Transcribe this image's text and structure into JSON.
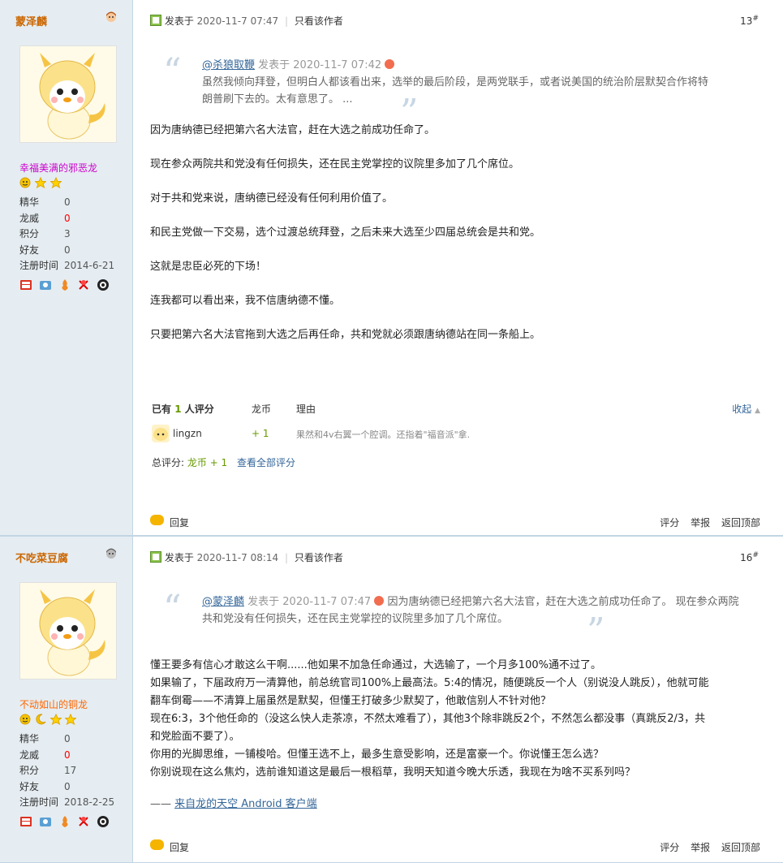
{
  "posts": [
    {
      "author": {
        "name": "蒙泽麟",
        "group": "幸福美满的邪恶龙",
        "stats": [
          {
            "label": "精华",
            "value": "0"
          },
          {
            "label": "龙威",
            "value": "0"
          },
          {
            "label": "积分",
            "value": "3"
          },
          {
            "label": "好友",
            "value": "0"
          },
          {
            "label": "注册时间",
            "value": "2014-6-21"
          }
        ]
      },
      "meta": {
        "prefix": "发表于",
        "date": "2020-11-7 07:47",
        "only_author": "只看该作者"
      },
      "floor": "13",
      "quote": {
        "user": "@杀狼取鞭",
        "meta": "发表于 2020-11-7 07:42",
        "line1": "虽然我倾向拜登，但明白人都该看出来，选举的最后阶段，是两党联手，或者说美国的统治阶层默契合作将特",
        "line2": "朗普刷下去的。太有意思了。  ..."
      },
      "paragraphs": [
        "因为唐纳德已经把第六名大法官，赶在大选之前成功任命了。",
        "现在参众两院共和党没有任何损失，还在民主党掌控的议院里多加了几个席位。",
        "对于共和党来说，唐纳德已经没有任何利用价值了。",
        "和民主党做一下交易，选个过渡总统拜登，之后未来大选至少四届总统会是共和党。",
        "这就是忠臣必死的下场！",
        "连我都可以看出来，我不信唐纳德不懂。",
        "只要把第六名大法官拖到大选之后再任命，共和党就必须跟唐纳德站在同一条船上。"
      ],
      "rating": {
        "prefix": "已有",
        "count": "1",
        "suffix": "人评分",
        "col_currency": "龙币",
        "col_reason": "理由",
        "collapse": "收起",
        "rater": "lingzn",
        "plus": "+ 1",
        "reason": "果然和4v右翼一个腔调。还指着\"福音派\"拿.",
        "total_label": "总评分:",
        "total_value": "龙币 + 1",
        "view_all": "查看全部评分"
      },
      "footer": {
        "reply": "回复",
        "rate": "评分",
        "report": "举报",
        "top": "返回顶部"
      }
    },
    {
      "author": {
        "name": "不吃菜豆腐",
        "group": "不动如山的铜龙",
        "stats": [
          {
            "label": "精华",
            "value": "0"
          },
          {
            "label": "龙威",
            "value": "0"
          },
          {
            "label": "积分",
            "value": "17"
          },
          {
            "label": "好友",
            "value": "0"
          },
          {
            "label": "注册时间",
            "value": "2018-2-25"
          }
        ]
      },
      "meta": {
        "prefix": "发表于",
        "date": "2020-11-7 08:14",
        "only_author": "只看该作者"
      },
      "floor": "16",
      "quote": {
        "user": "@蒙泽麟",
        "meta": "发表于 2020-11-7 07:47",
        "line1_tail": "因为唐纳德已经把第六名大法官，赶在大选之前成功任命了。 现在参众两院",
        "line2": "共和党没有任何损失，还在民主党掌控的议院里多加了几个席位。"
      },
      "paragraphs": [
        "懂王要多有信心才敢这么干啊......他如果不加急任命通过，大选输了，一个月多100%通不过了。",
        "  如果输了，下届政府万一清算他，前总统官司100%上最高法。5:4的情况，随便跳反一个人（别说没人跳反），他就可能",
        "翻车倒霉——不清算上届虽然是默契，但懂王打破多少默契了，他敢信别人不针对他？",
        "  现在6:3，3个他任命的（没这么快人走茶凉，不然太难看了），其他3个除非跳反2个，不然怎么都没事（真跳反2/3，共",
        "和党脸面不要了）。",
        "  你用的光脚思维，一铺梭哈。但懂王选不上，最多生意受影响，还是富豪一个。你说懂王怎么选？",
        "  你别说现在这么焦灼，选前谁知道这是最后一根稻草，我明天知道今晚大乐透，我现在为啥不买系列吗？"
      ],
      "signature": {
        "dash": "——",
        "link": "来自龙的天空 Android 客户端"
      },
      "footer": {
        "reply": "回复",
        "rate": "评分",
        "report": "举报",
        "top": "返回顶部"
      }
    }
  ],
  "colors": {
    "sidebar_bg": "#e5edf2",
    "link": "#369",
    "username": "#c60",
    "group1": "#c0c",
    "group2": "#f60",
    "rating_green": "#690"
  },
  "icons": [
    "male-avatar-icon",
    "female-avatar-icon",
    "star-icon",
    "medal-icon",
    "online-icon",
    "reply-bubble-icon"
  ]
}
